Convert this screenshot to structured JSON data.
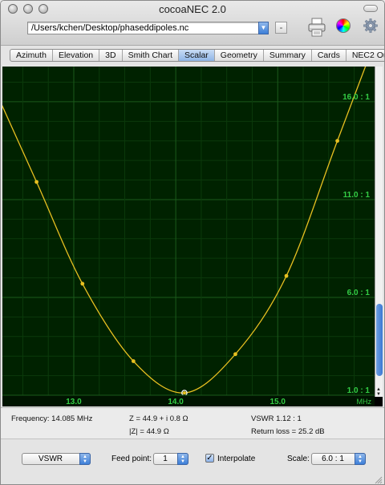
{
  "window": {
    "title": "cocoaNEC 2.0"
  },
  "toolbar": {
    "file_path": "/Users/kchen/Desktop/phaseddipoles.nc",
    "minus_label": "-"
  },
  "tabs": [
    {
      "label": "Azimuth",
      "active": false
    },
    {
      "label": "Elevation",
      "active": false
    },
    {
      "label": "3D",
      "active": false
    },
    {
      "label": "Smith Chart",
      "active": false
    },
    {
      "label": "Scalar",
      "active": true
    },
    {
      "label": "Geometry",
      "active": false
    },
    {
      "label": "Summary",
      "active": false
    },
    {
      "label": "Cards",
      "active": false
    },
    {
      "label": "NEC2 Output",
      "active": false
    }
  ],
  "chart_data": {
    "type": "line",
    "series": [
      {
        "points": [
          [
            12.635,
            11.9
          ],
          [
            13.085,
            6.7
          ],
          [
            13.585,
            2.74
          ],
          [
            14.085,
            1.12
          ],
          [
            14.585,
            3.1
          ],
          [
            15.085,
            7.1
          ],
          [
            15.585,
            14.0
          ]
        ],
        "color": "#e8c020"
      }
    ],
    "xlim": [
      12.3,
      15.95
    ],
    "ylim": [
      1.0,
      17.8
    ],
    "x_ticks": [
      "13.0",
      "14.0",
      "15.0"
    ],
    "x_tick_values": [
      13.0,
      14.0,
      15.0
    ],
    "x_unit": "MHz",
    "y_ticks": [
      "1.0 : 1",
      "6.0 : 1",
      "11.0 : 1",
      "16.0 : 1"
    ],
    "y_tick_values": [
      1.0,
      6.0,
      11.0,
      16.0
    ],
    "minor_grid_step": 1.0,
    "marker_x": 14.085,
    "grid": true,
    "colors": {
      "background": "#002200",
      "grid": "#0b3a0b",
      "major_grid": "#1b5a1b",
      "curve": "#e8c020",
      "labels": "#33cc44"
    }
  },
  "info": {
    "frequency": "Frequency: 14.085 MHz",
    "impedance": "Z = 44.9 + i 0.8 Ω",
    "magnitude": "|Z| = 44.9 Ω",
    "vswr": "VSWR 1.12 : 1",
    "return_loss": "Return loss = 25.2 dB"
  },
  "controls": {
    "plot_type": "VSWR",
    "feed_point_label": "Feed point:",
    "feed_point": "1",
    "interpolate_label": "Interpolate",
    "interpolate_checked": true,
    "scale_label": "Scale:",
    "scale": "6.0 : 1"
  }
}
